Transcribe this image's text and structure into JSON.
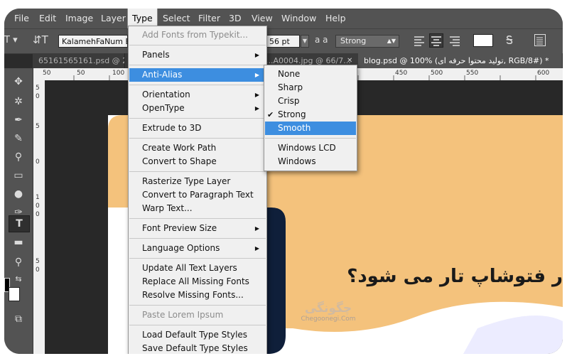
{
  "menubar": [
    "File",
    "Edit",
    "Image",
    "Layer",
    "Type",
    "Select",
    "Filter",
    "3D",
    "View",
    "Window",
    "Help"
  ],
  "options_bar": {
    "font_family": "KalamehFaNum Black",
    "font_size": "56 pt",
    "aa_icon": "a a",
    "anti_alias": "Strong"
  },
  "tabs": [
    "65161565161.psd @ 25%...",
    "...A0004.jpg @ 66/7...",
    "blog.psd @ 100% (تولید محتوا حرفه ای, RGB/8#) *"
  ],
  "ruler_top": [
    "50",
    "50",
    "100",
    "450",
    "500",
    "550",
    "600"
  ],
  "ruler_left": [
    "5",
    "0",
    "5",
    "0",
    "1",
    "0",
    "0",
    "5",
    "0"
  ],
  "type_menu": {
    "items": [
      {
        "label": "Add Fonts from Typekit...",
        "disabled": true
      },
      {
        "sep": true
      },
      {
        "label": "Panels",
        "submenu": true
      },
      {
        "sep": true
      },
      {
        "label": "Anti-Alias",
        "submenu": true,
        "highlight": true
      },
      {
        "sep": true
      },
      {
        "label": "Orientation",
        "submenu": true
      },
      {
        "label": "OpenType",
        "submenu": true
      },
      {
        "sep": true
      },
      {
        "label": "Extrude to 3D"
      },
      {
        "sep": true
      },
      {
        "label": "Create Work Path"
      },
      {
        "label": "Convert to Shape"
      },
      {
        "sep": true
      },
      {
        "label": "Rasterize Type Layer"
      },
      {
        "label": "Convert to Paragraph Text"
      },
      {
        "label": "Warp Text..."
      },
      {
        "sep": true
      },
      {
        "label": "Font Preview Size",
        "submenu": true
      },
      {
        "sep": true
      },
      {
        "label": "Language Options",
        "submenu": true
      },
      {
        "sep": true
      },
      {
        "label": "Update All Text Layers"
      },
      {
        "label": "Replace All Missing Fonts"
      },
      {
        "label": "Resolve Missing Fonts..."
      },
      {
        "sep": true
      },
      {
        "label": "Paste Lorem Ipsum",
        "disabled": true
      },
      {
        "sep": true
      },
      {
        "label": "Load Default Type Styles"
      },
      {
        "label": "Save Default Type Styles"
      }
    ]
  },
  "anti_alias_menu": {
    "items": [
      {
        "label": "None"
      },
      {
        "label": "Sharp"
      },
      {
        "label": "Crisp"
      },
      {
        "label": "Strong",
        "checked": true
      },
      {
        "label": "Smooth",
        "highlight": true
      },
      {
        "sep": true
      },
      {
        "label": "Windows LCD"
      },
      {
        "label": "Windows"
      }
    ]
  },
  "document": {
    "headline": "ر فتوشاپ تار می شود؟",
    "watermark_name": "چگونگی",
    "watermark_url": "Chegoonegi.Com"
  },
  "colors": {
    "highlight": "#3d8ee0",
    "doc_orange": "#f4c27c",
    "doc_navy": "#0f1f3a"
  }
}
